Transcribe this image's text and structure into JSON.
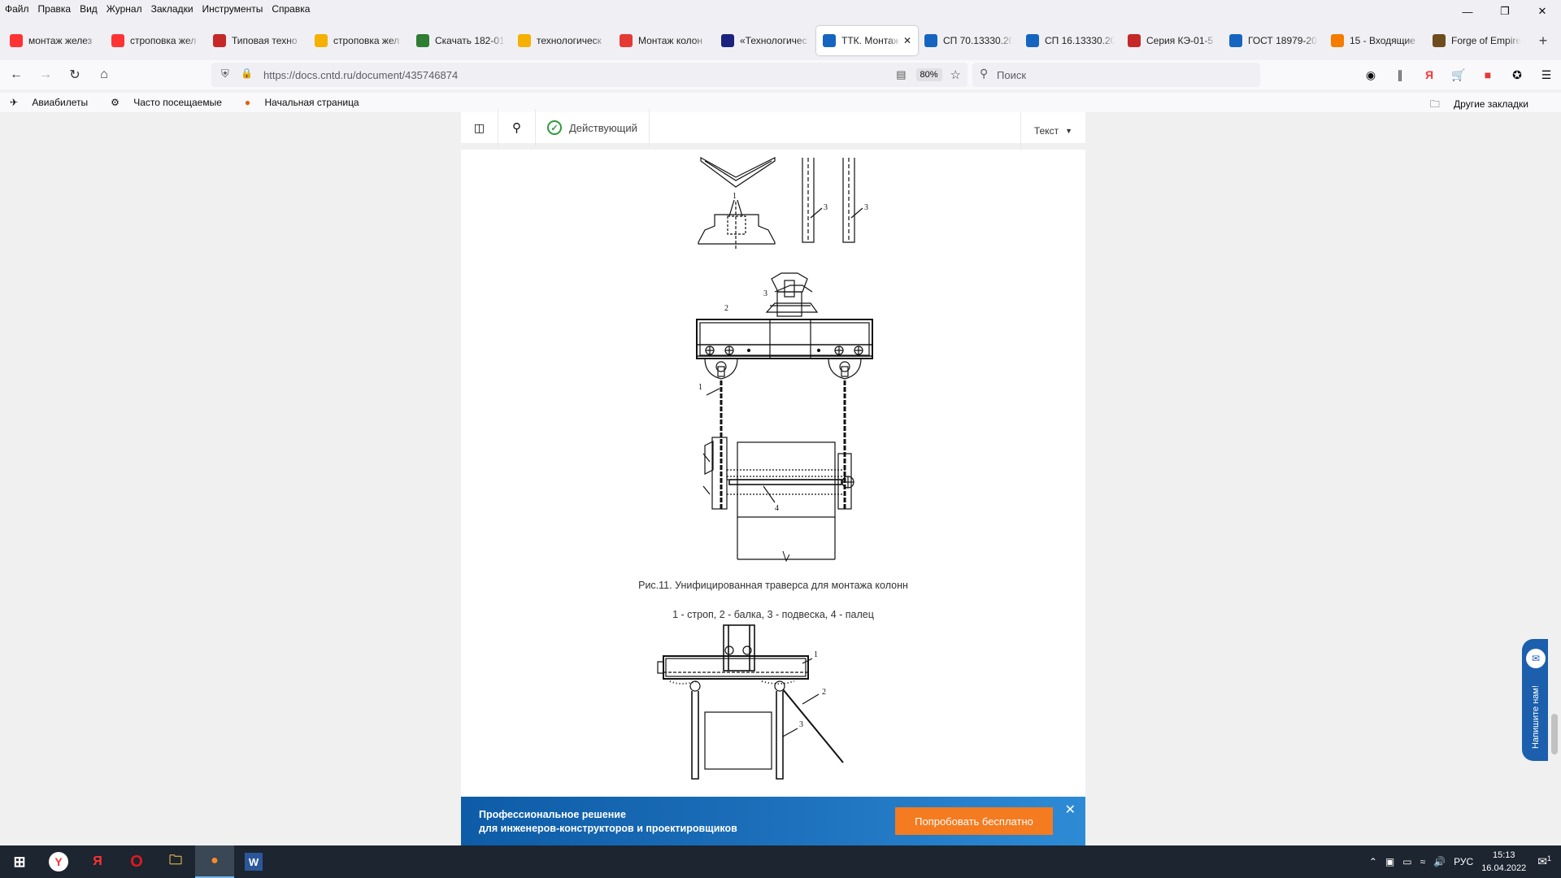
{
  "menubar": {
    "items": [
      "Файл",
      "Правка",
      "Вид",
      "Журнал",
      "Закладки",
      "Инструменты",
      "Справка"
    ]
  },
  "tabs": [
    {
      "title": "монтаж желез",
      "icon": "yandex-icon",
      "color": "#f33"
    },
    {
      "title": "строповка жел",
      "icon": "yandex-icon",
      "color": "#f33"
    },
    {
      "title": "Типовая техно",
      "icon": "p-icon",
      "color": "#c62828"
    },
    {
      "title": "строповка жел",
      "icon": "image-icon",
      "color": "#f5b000"
    },
    {
      "title": "Скачать 182-01",
      "icon": "gear-icon",
      "color": "#2e7d32"
    },
    {
      "title": "технологическ",
      "icon": "image-icon",
      "color": "#f5b000"
    },
    {
      "title": "Монтаж колон",
      "icon": "s-icon",
      "color": "#e53935"
    },
    {
      "title": "«Технологичес",
      "icon": "doc-icon",
      "color": "#1a237e"
    },
    {
      "title": "ТТК. Монтаж",
      "icon": "cntd-icon",
      "color": "#1565c0",
      "active": true
    },
    {
      "title": "СП 70.13330.20",
      "icon": "cntd-icon",
      "color": "#1565c0"
    },
    {
      "title": "СП 16.13330.20",
      "icon": "cntd-icon",
      "color": "#1565c0"
    },
    {
      "title": "Серия КЭ-01-5",
      "icon": "flag-icon",
      "color": "#c62828"
    },
    {
      "title": "ГОСТ 18979-20",
      "icon": "cntd-icon",
      "color": "#1565c0"
    },
    {
      "title": "15 - Входящие",
      "icon": "mail-icon",
      "color": "#f57c00"
    },
    {
      "title": "Forge of Empire",
      "icon": "game-icon",
      "color": "#6d4c1d"
    }
  ],
  "nav": {
    "url": "https://docs.cntd.ru/document/435746874",
    "zoom": "80%",
    "search_placeholder": "Поиск"
  },
  "bookmarks": {
    "items": [
      "Авиабилеты",
      "Часто посещаемые",
      "Начальная страница"
    ],
    "other": "Другие закладки"
  },
  "doctoolbar": {
    "status": "Действующий",
    "mode": "Текст"
  },
  "figure": {
    "caption": "Рис.11. Унифицированная траверса для монтажа колонн",
    "legend": "1 - строп, 2 - балка, 3 - подвеска, 4 - палец",
    "labels": [
      "1",
      "2",
      "3",
      "4"
    ]
  },
  "banner": {
    "line1": "Профессиональное решение",
    "line2": "для инженеров-конструкторов и проектировщиков",
    "button": "Попробовать бесплатно"
  },
  "feedback": {
    "label": "Напишите нам!"
  },
  "taskbar": {
    "lang": "РУС",
    "time": "15:13",
    "date": "16.04.2022",
    "notif": "1"
  }
}
